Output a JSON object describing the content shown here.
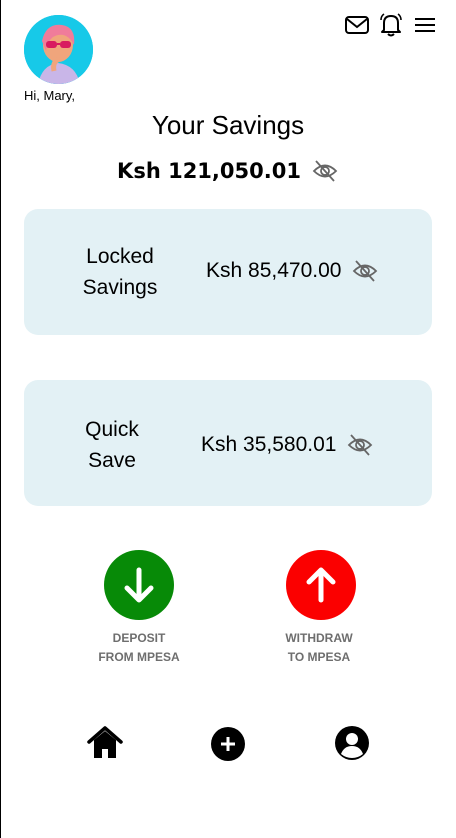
{
  "header": {
    "greeting": "Hi, Mary,",
    "icons": [
      "mail-icon",
      "bell-icon",
      "menu-icon"
    ]
  },
  "summary": {
    "title": "Your Savings",
    "total": "Ksh 121,050.01"
  },
  "accounts": [
    {
      "label_line1": "Locked",
      "label_line2": "Savings",
      "amount": "Ksh 85,470.00"
    },
    {
      "label_line1": "Quick",
      "label_line2": "Save",
      "amount": "Ksh 35,580.01"
    }
  ],
  "actions": {
    "deposit": {
      "line1": "DEPOSIT",
      "line2": "FROM MPESA",
      "color": "#078a07"
    },
    "withdraw": {
      "line1": "WITHDRAW",
      "line2": "TO MPESA",
      "color": "#fb0000"
    }
  },
  "bottom_nav": [
    "home-icon",
    "add-icon",
    "profile-icon"
  ],
  "colors": {
    "card_bg": "#e3f1f5",
    "avatar_bg": "#17c9e8"
  }
}
